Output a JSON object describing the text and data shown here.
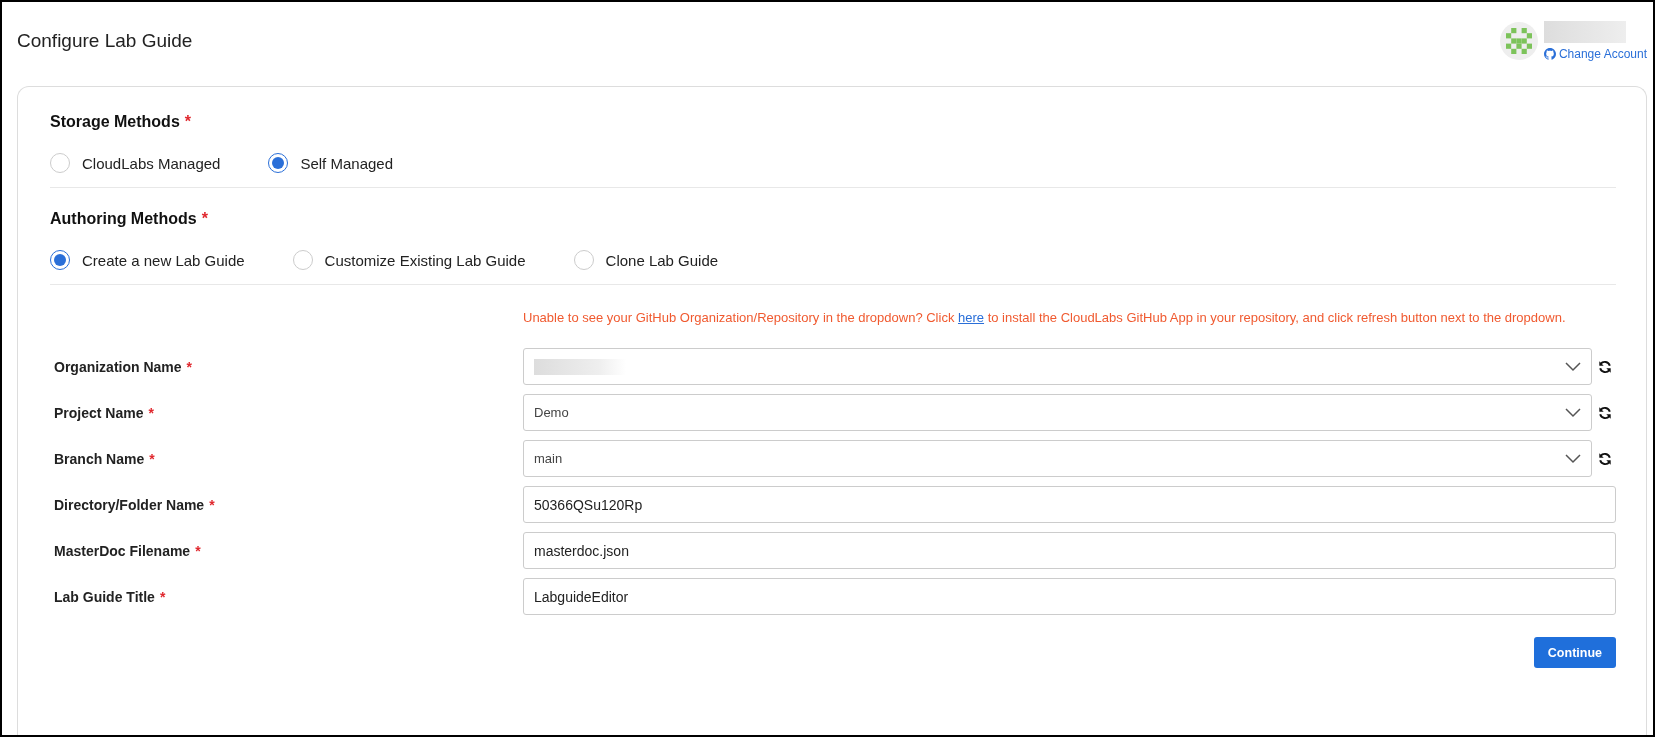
{
  "header": {
    "title": "Configure Lab Guide",
    "account": {
      "change_link": "Change Account"
    }
  },
  "storage": {
    "heading": "Storage Methods",
    "required_mark": "*",
    "options": [
      {
        "label": "CloudLabs Managed",
        "selected": false
      },
      {
        "label": "Self Managed",
        "selected": true
      }
    ]
  },
  "authoring": {
    "heading": "Authoring Methods",
    "required_mark": "*",
    "options": [
      {
        "label": "Create a new Lab Guide",
        "selected": true
      },
      {
        "label": "Customize Existing Lab Guide",
        "selected": false
      },
      {
        "label": "Clone Lab Guide",
        "selected": false
      }
    ]
  },
  "notice": {
    "before": "Unable to see your GitHub Organization/Repository in the dropdown? Click ",
    "link": "here",
    "after": " to install the CloudLabs GitHub App in your repository, and click refresh button next to the dropdown."
  },
  "fields": [
    {
      "kind": "select",
      "label": "Organization Name",
      "required_mark": "*",
      "redacted": true
    },
    {
      "kind": "select",
      "label": "Project Name",
      "required_mark": "*",
      "value": "Demo"
    },
    {
      "kind": "select",
      "label": "Branch Name",
      "required_mark": "*",
      "value": "main"
    },
    {
      "kind": "text",
      "label": "Directory/Folder Name",
      "required_mark": "*",
      "value": "50366QSu120Rp"
    },
    {
      "kind": "text",
      "label": "MasterDoc Filename",
      "required_mark": "*",
      "value": "masterdoc.json"
    },
    {
      "kind": "text",
      "label": "Lab Guide Title",
      "required_mark": "*",
      "value": "LabguideEditor"
    }
  ],
  "buttons": [
    {
      "label": "Continue"
    }
  ]
}
